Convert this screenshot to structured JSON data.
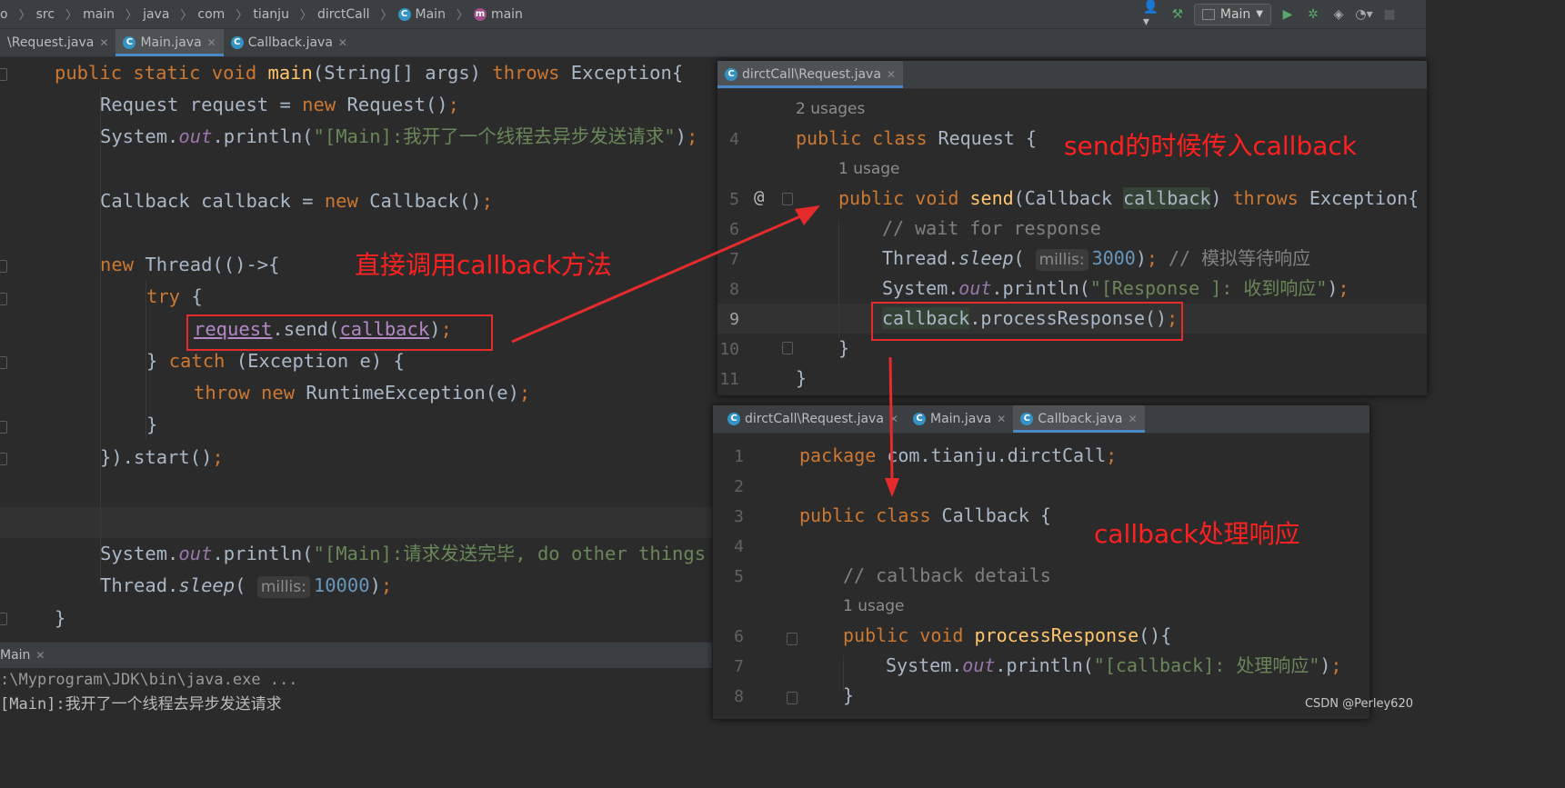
{
  "navbar": {
    "crumbs": [
      "o",
      "src",
      "main",
      "java",
      "com",
      "tianju",
      "dirctCall",
      "Main",
      "main"
    ],
    "run_config": "Main"
  },
  "main_tabs": [
    "\\Request.java",
    "Main.java",
    "Callback.java"
  ],
  "main_code": {
    "lines": [
      "public static void main(String[] args) throws Exception{",
      "Request request = new Request();",
      "System.out.println(\"[Main]:我开了一个线程去异步发送请求\");",
      "Callback callback = new Callback();",
      "new Thread(()->{",
      "try {",
      "request.send(callback);",
      "} catch (Exception e) {",
      "throw new RuntimeException(e);",
      "}",
      "}).start();",
      "System.out.println(\"[Main]:请求发送完毕, do other things",
      "Thread.sleep( millis: 10000);",
      "}"
    ],
    "hint_millis": "millis:",
    "sleep_value": "10000"
  },
  "run_panel": {
    "tab": "Main",
    "lines": [
      ":\\Myprogram\\JDK\\bin\\java.exe ...",
      "[Main]:我开了一个线程去异步发送请求"
    ]
  },
  "request_panel": {
    "tab": "dirctCall\\Request.java",
    "usage_top": "2 usages",
    "usage_send": "1 usage",
    "line_numbers": [
      "4",
      "5",
      "6",
      "7",
      "8",
      "9",
      "10",
      "11"
    ],
    "at_symbol": "@",
    "code": {
      "class_decl": "public class Request {",
      "send_decl": "public void send(Callback callback) throws Exception{",
      "comment": "// wait for response",
      "sleep": "Thread.sleep( millis: 3000); // 模拟等待响应",
      "println": "System.out.println(\"[Response ]: 收到响应\");",
      "callback_call": "callback.processResponse();",
      "close1": "}",
      "close2": "}"
    },
    "sleep_value": "3000",
    "sleep_comment": "// 模拟等待响应",
    "response_string": "\"[Response ]: 收到响应\""
  },
  "callback_panel": {
    "tabs": [
      "dirctCall\\Request.java",
      "Main.java",
      "Callback.java"
    ],
    "usage": "1 usage",
    "line_numbers": [
      "1",
      "2",
      "3",
      "4",
      "5",
      "6",
      "7",
      "8"
    ],
    "code": {
      "package": "package com.tianju.dirctCall;",
      "class_decl": "public class Callback {",
      "comment": "// callback details",
      "method_decl": "public void processResponse(){",
      "println": "System.out.println(\"[callback]: 处理响应\");",
      "close": "}"
    },
    "callback_string": "\"[callback]: 处理响应\""
  },
  "annotations": {
    "direct_call": "直接调用callback方法",
    "send_pass": "send的时候传入callback",
    "callback_handle": "callback处理响应"
  },
  "watermark": "CSDN @Perley620",
  "colors": {
    "keyword": "#cc7832",
    "function": "#ffc66d",
    "string": "#6a8759",
    "number": "#6897bb",
    "comment": "#808080",
    "annotation_red": "#ff2020",
    "tab_accent": "#4a88c7"
  }
}
